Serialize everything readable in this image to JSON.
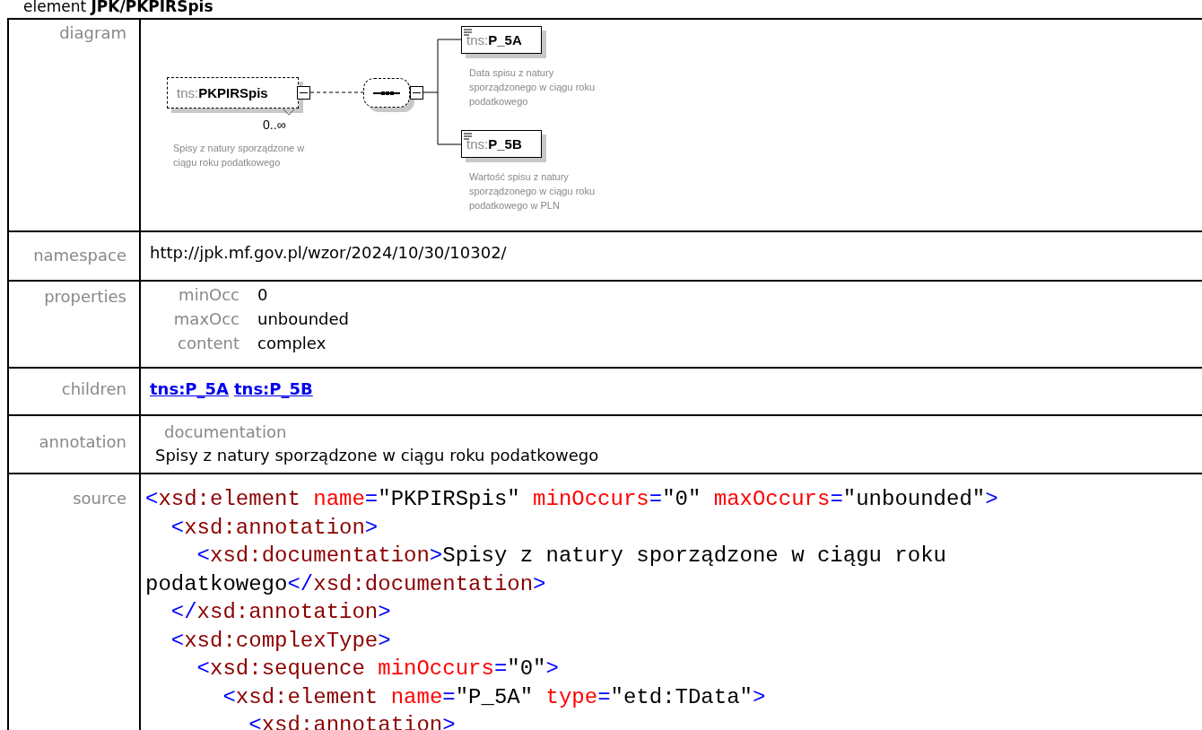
{
  "heading": {
    "prefix": "element",
    "name": "JPK/PKPIRSpis"
  },
  "diagram": {
    "label": "diagram",
    "element": {
      "prefix": "tns:",
      "name": "PKPIRSpis",
      "multiplicity": "0..∞",
      "description": "Spisy z natury sporządzone w ciągu roku podatkowego"
    },
    "children": [
      {
        "prefix": "tns:",
        "name": "P_5A",
        "description": "Data spisu z natury sporządzonego w ciągu roku podatkowego"
      },
      {
        "prefix": "tns:",
        "name": "P_5B",
        "description": "Wartość spisu z natury sporządzonego w ciągu roku podatkowego w PLN"
      }
    ]
  },
  "namespace": {
    "label": "namespace",
    "value": "http://jpk.mf.gov.pl/wzor/2024/10/30/10302/"
  },
  "properties": {
    "label": "properties",
    "items": [
      {
        "name": "minOcc",
        "value": "0"
      },
      {
        "name": "maxOcc",
        "value": "unbounded"
      },
      {
        "name": "content",
        "value": "complex"
      }
    ]
  },
  "children": {
    "label": "children",
    "links": [
      "tns:P_5A",
      "tns:P_5B"
    ]
  },
  "annotation": {
    "label": "annotation",
    "title": "documentation",
    "text": "Spisy z natury sporządzone w ciągu roku podatkowego"
  },
  "source": {
    "label": "source",
    "lines": [
      [
        {
          "kind": "punct",
          "text": "<"
        },
        {
          "kind": "tag",
          "text": "xsd:element"
        },
        {
          "kind": "attr",
          "text": " name"
        },
        {
          "kind": "punct",
          "text": "="
        },
        {
          "kind": "value",
          "text": "\"PKPIRSpis\""
        },
        {
          "kind": "attr",
          "text": " minOccurs"
        },
        {
          "kind": "punct",
          "text": "="
        },
        {
          "kind": "value",
          "text": "\"0\""
        },
        {
          "kind": "attr",
          "text": " maxOccurs"
        },
        {
          "kind": "punct",
          "text": "="
        },
        {
          "kind": "value",
          "text": "\"unbounded\""
        },
        {
          "kind": "punct",
          "text": ">"
        }
      ],
      [
        {
          "kind": "punct",
          "text": "  <"
        },
        {
          "kind": "tag",
          "text": "xsd:annotation"
        },
        {
          "kind": "punct",
          "text": ">"
        }
      ],
      [
        {
          "kind": "punct",
          "text": "    <"
        },
        {
          "kind": "tag",
          "text": "xsd:documentation"
        },
        {
          "kind": "punct",
          "text": ">"
        },
        {
          "kind": "text",
          "text": "Spisy z natury sporządzone w ciągu roku"
        }
      ],
      [
        {
          "kind": "text",
          "text": "podatkowego"
        },
        {
          "kind": "punct",
          "text": "</"
        },
        {
          "kind": "tag",
          "text": "xsd:documentation"
        },
        {
          "kind": "punct",
          "text": ">"
        }
      ],
      [
        {
          "kind": "punct",
          "text": "  </"
        },
        {
          "kind": "tag",
          "text": "xsd:annotation"
        },
        {
          "kind": "punct",
          "text": ">"
        }
      ],
      [
        {
          "kind": "punct",
          "text": "  <"
        },
        {
          "kind": "tag",
          "text": "xsd:complexType"
        },
        {
          "kind": "punct",
          "text": ">"
        }
      ],
      [
        {
          "kind": "punct",
          "text": "    <"
        },
        {
          "kind": "tag",
          "text": "xsd:sequence"
        },
        {
          "kind": "attr",
          "text": " minOccurs"
        },
        {
          "kind": "punct",
          "text": "="
        },
        {
          "kind": "value",
          "text": "\"0\""
        },
        {
          "kind": "punct",
          "text": ">"
        }
      ],
      [
        {
          "kind": "punct",
          "text": "      <"
        },
        {
          "kind": "tag",
          "text": "xsd:element"
        },
        {
          "kind": "attr",
          "text": " name"
        },
        {
          "kind": "punct",
          "text": "="
        },
        {
          "kind": "value",
          "text": "\"P_5A\""
        },
        {
          "kind": "attr",
          "text": " type"
        },
        {
          "kind": "punct",
          "text": "="
        },
        {
          "kind": "value",
          "text": "\"etd:TData\""
        },
        {
          "kind": "punct",
          "text": ">"
        }
      ],
      [
        {
          "kind": "punct",
          "text": "        <"
        },
        {
          "kind": "tag",
          "text": "xsd:annotation"
        },
        {
          "kind": "punct",
          "text": ">"
        }
      ]
    ]
  }
}
